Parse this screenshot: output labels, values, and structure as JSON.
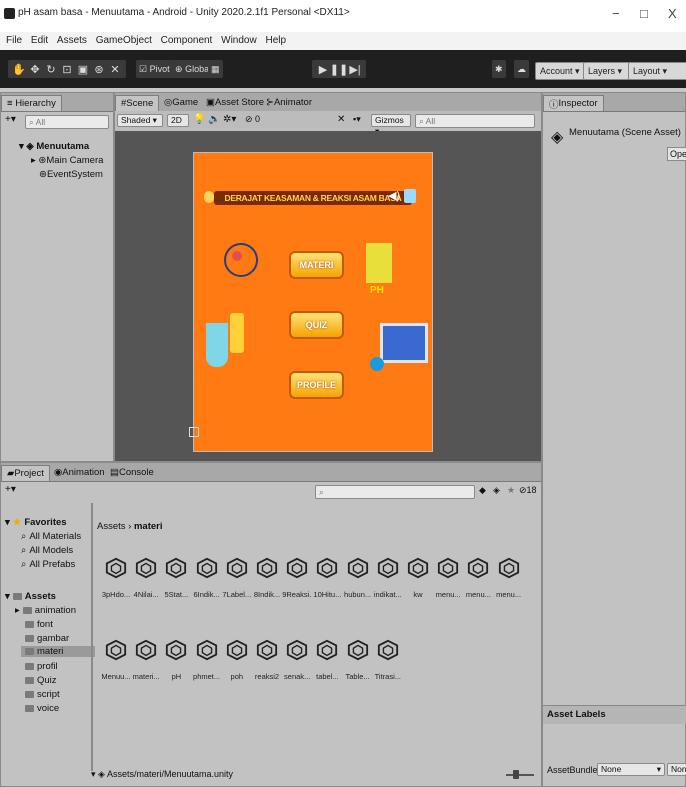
{
  "window": {
    "title": "pH asam basa - Menuutama - Android - Unity 2020.2.1f1 Personal <DX11>",
    "min": "−",
    "max": "□",
    "close": "X"
  },
  "menu": [
    "File",
    "Edit",
    "Assets",
    "GameObject",
    "Component",
    "Window",
    "Help"
  ],
  "toolbar": {
    "pivot": "Pivot",
    "global": "Global",
    "account": "Account",
    "layers": "Layers",
    "layout": "Layout"
  },
  "hierarchy": {
    "tab": "Hierarchy",
    "search_placeholder": "All",
    "scene": "Menuutama",
    "items": [
      "Main Camera",
      "EventSystem"
    ]
  },
  "scene": {
    "tabs": [
      "Scene",
      "Game",
      "Asset Store",
      "Animator"
    ],
    "shading": "Shaded",
    "mode_2d": "2D",
    "gizmos": "Gizmos",
    "search_placeholder": "All",
    "fx_count": "0"
  },
  "game": {
    "banner": "DERAJAT KEASAMAN & REAKSI ASAM BASA",
    "ph_label": "PH",
    "buttons": [
      "MATERI",
      "QUIZ",
      "PROFILE"
    ]
  },
  "inspector": {
    "tab": "Inspector",
    "asset_name": "Menuutama (Scene Asset)",
    "open_button": "Open",
    "asset_labels": "Asset Labels",
    "assetbundle_label": "AssetBundle",
    "assetbundle_value": "None",
    "variant_value": "None"
  },
  "project": {
    "tabs": [
      "Project",
      "Animation",
      "Console"
    ],
    "hidden_count": "18",
    "favorites": {
      "label": "Favorites",
      "items": [
        "All Materials",
        "All Models",
        "All Prefabs"
      ]
    },
    "assets": {
      "label": "Assets",
      "folders": [
        "animation",
        "font",
        "gambar",
        "materi",
        "profil",
        "Quiz",
        "script",
        "voice"
      ]
    },
    "breadcrumb": [
      "Assets",
      "materi"
    ],
    "row1": [
      "3pHdo...",
      "4Nilai...",
      "5Stat...",
      "6Indik...",
      "7Label...",
      "8Indik...",
      "9Reaksi...",
      "10Hitu...",
      "hubun...",
      "indikat...",
      "kw",
      "menu...",
      "menu...",
      "menu..."
    ],
    "row2": [
      "Menuu...",
      "materi...",
      "pH",
      "phmet...",
      "poh",
      "reaksi2",
      "senak...",
      "tabel...",
      "Table...",
      "Titrasi..."
    ],
    "status_path": "Assets/materi/Menuutama.unity"
  },
  "colors": {
    "game_bg": "#ff7a12",
    "button_border": "#c45b00",
    "toolbar": "#1f1f1f"
  }
}
